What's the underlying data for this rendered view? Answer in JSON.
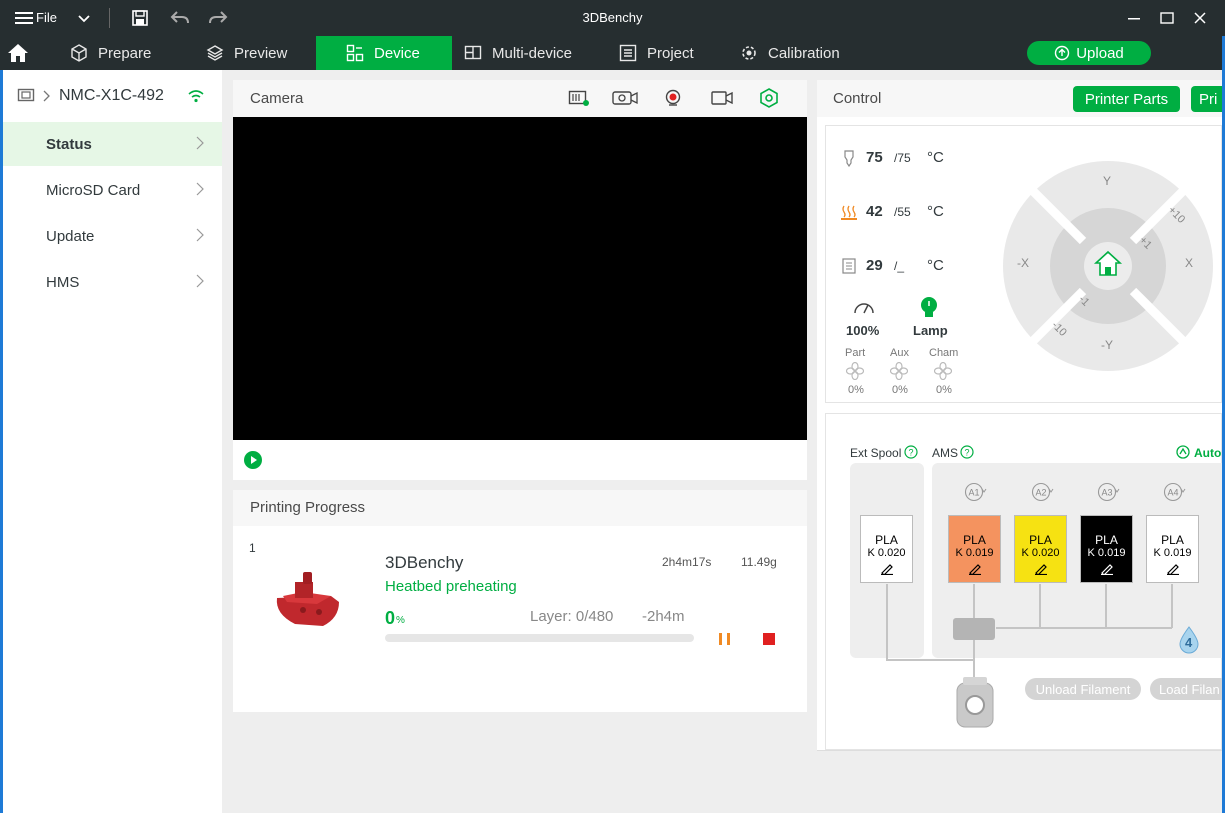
{
  "window": {
    "title": "3DBenchy",
    "menu_label": "File"
  },
  "tabs": [
    {
      "label": "Prepare",
      "icon": "cube-icon"
    },
    {
      "label": "Preview",
      "icon": "layers-icon"
    },
    {
      "label": "Device",
      "icon": "device-icon",
      "active": true
    },
    {
      "label": "Multi-device",
      "icon": "multi-device-icon"
    },
    {
      "label": "Project",
      "icon": "project-icon"
    },
    {
      "label": "Calibration",
      "icon": "calibration-icon"
    }
  ],
  "upload_label": "Upload",
  "sidebar": {
    "printer_name": "NMC-X1C-492",
    "items": [
      {
        "label": "Status",
        "active": true
      },
      {
        "label": "MicroSD Card"
      },
      {
        "label": "Update"
      },
      {
        "label": "HMS"
      }
    ]
  },
  "camera": {
    "title": "Camera"
  },
  "progress": {
    "title": "Printing Progress",
    "plate_number": "1",
    "model_name": "3DBenchy",
    "duration": "2h4m17s",
    "weight": "11.49g",
    "status": "Heatbed preheating",
    "percent": "0",
    "percent_unit": "%",
    "layer": "Layer: 0/480",
    "remaining": "-2h4m",
    "progress_fraction": 0
  },
  "control": {
    "title": "Control",
    "printer_parts_label": "Printer Parts",
    "second_button_label": "Pri",
    "nozzle": {
      "current": "75",
      "target": "/75",
      "unit": "°C"
    },
    "bed": {
      "current": "42",
      "target": "/55",
      "unit": "°C"
    },
    "chamber": {
      "current": "29",
      "target": "/_",
      "unit": "°C"
    },
    "speed": "100%",
    "lamp": "Lamp",
    "fans": [
      {
        "label": "Part",
        "value": "0%"
      },
      {
        "label": "Aux",
        "value": "0%"
      },
      {
        "label": "Cham",
        "value": "0%"
      }
    ],
    "jog": {
      "y_plus": "Y",
      "y_minus": "-Y",
      "x_minus": "-X",
      "x_plus": "X",
      "plus10": "+10",
      "plus1": "+1",
      "minus1": "-1",
      "minus10": "-10"
    }
  },
  "ams": {
    "ext_spool_label": "Ext Spool",
    "ams_label": "AMS",
    "auto_label": "Auto",
    "ext_tray": {
      "material": "PLA",
      "k": "K 0.020"
    },
    "slots": [
      {
        "id": "A1",
        "material": "PLA",
        "k": "K 0.019",
        "color": "#f4935f",
        "text_color": "#000000"
      },
      {
        "id": "A2",
        "material": "PLA",
        "k": "K 0.020",
        "color": "#f6e212",
        "text_color": "#000000"
      },
      {
        "id": "A3",
        "material": "PLA",
        "k": "K 0.019",
        "color": "#000000",
        "text_color": "#ffffff"
      },
      {
        "id": "A4",
        "material": "PLA",
        "k": "K 0.019",
        "color": "#ffffff",
        "text_color": "#000000"
      }
    ],
    "humidity_level": "4",
    "unload_label": "Unload Filament",
    "load_label": "Load Filan"
  },
  "colors": {
    "accent": "#00ae42",
    "titlebar": "#262e30",
    "pause": "#f08a24",
    "stop": "#e02020"
  }
}
